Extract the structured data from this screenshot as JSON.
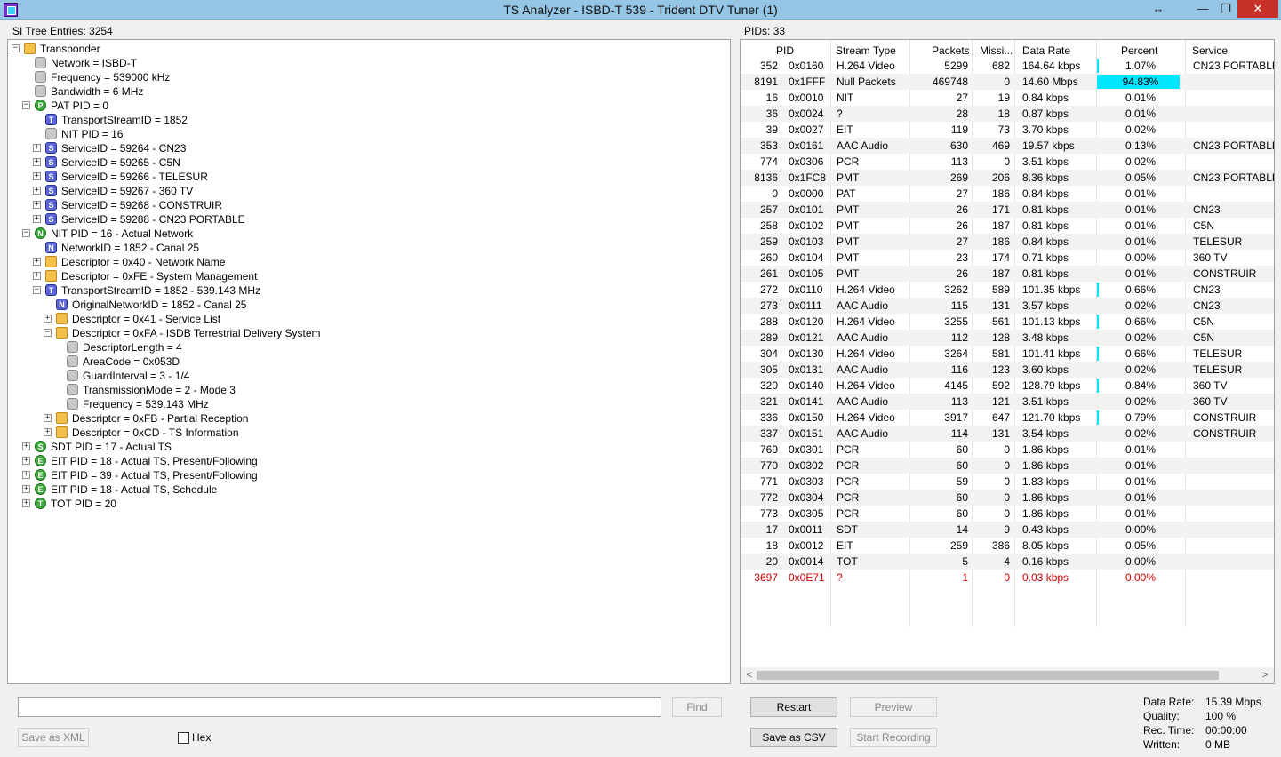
{
  "window": {
    "title": "TS Analyzer - ISBD-T 539 - Trident DTV Tuner (1)"
  },
  "left": {
    "label": "SI Tree Entries: 3254",
    "tree": [
      {
        "level": 0,
        "exp": "-",
        "icon": "folder",
        "text": "Transponder"
      },
      {
        "level": 1,
        "exp": "",
        "icon": "leaf",
        "text": "Network = ISBD-T"
      },
      {
        "level": 1,
        "exp": "",
        "icon": "leaf",
        "text": "Frequency = 539000 kHz"
      },
      {
        "level": 1,
        "exp": "",
        "icon": "leaf",
        "text": "Bandwidth = 6 MHz"
      },
      {
        "level": 1,
        "exp": "-",
        "icon": "P",
        "text": "PAT PID = 0"
      },
      {
        "level": 2,
        "exp": "",
        "icon": "T",
        "text": "TransportStreamID = 1852"
      },
      {
        "level": 2,
        "exp": "",
        "icon": "leaf",
        "text": "NIT PID = 16"
      },
      {
        "level": 2,
        "exp": "+",
        "icon": "S",
        "text": "ServiceID = 59264 - CN23"
      },
      {
        "level": 2,
        "exp": "+",
        "icon": "S",
        "text": "ServiceID = 59265 - C5N"
      },
      {
        "level": 2,
        "exp": "+",
        "icon": "S",
        "text": "ServiceID = 59266 - TELESUR"
      },
      {
        "level": 2,
        "exp": "+",
        "icon": "S",
        "text": "ServiceID = 59267 - 360 TV"
      },
      {
        "level": 2,
        "exp": "+",
        "icon": "S",
        "text": "ServiceID = 59268 - CONSTRUIR"
      },
      {
        "level": 2,
        "exp": "+",
        "icon": "S",
        "text": "ServiceID = 59288 - CN23 PORTABLE"
      },
      {
        "level": 1,
        "exp": "-",
        "icon": "N",
        "text": "NIT PID = 16 - Actual Network"
      },
      {
        "level": 2,
        "exp": "",
        "icon": "Nw",
        "text": "NetworkID = 1852 - Canal 25"
      },
      {
        "level": 2,
        "exp": "+",
        "icon": "folder",
        "text": "Descriptor = 0x40 - Network Name"
      },
      {
        "level": 2,
        "exp": "+",
        "icon": "folder",
        "text": "Descriptor = 0xFE - System Management"
      },
      {
        "level": 2,
        "exp": "-",
        "icon": "T",
        "text": "TransportStreamID = 1852 - 539.143 MHz"
      },
      {
        "level": 3,
        "exp": "",
        "icon": "Nw",
        "text": "OriginalNetworkID = 1852 - Canal 25"
      },
      {
        "level": 3,
        "exp": "+",
        "icon": "folder",
        "text": "Descriptor = 0x41 - Service List"
      },
      {
        "level": 3,
        "exp": "-",
        "icon": "folder",
        "text": "Descriptor = 0xFA - ISDB Terrestrial Delivery System"
      },
      {
        "level": 4,
        "exp": "",
        "icon": "leaf",
        "text": "DescriptorLength = 4"
      },
      {
        "level": 4,
        "exp": "",
        "icon": "leaf",
        "text": "AreaCode = 0x053D"
      },
      {
        "level": 4,
        "exp": "",
        "icon": "leaf",
        "text": "GuardInterval = 3 - 1/4"
      },
      {
        "level": 4,
        "exp": "",
        "icon": "leaf",
        "text": "TransmissionMode = 2 - Mode 3"
      },
      {
        "level": 4,
        "exp": "",
        "icon": "leaf",
        "text": "Frequency = 539.143 MHz"
      },
      {
        "level": 3,
        "exp": "+",
        "icon": "folder",
        "text": "Descriptor = 0xFB - Partial Reception"
      },
      {
        "level": 3,
        "exp": "+",
        "icon": "folder",
        "text": "Descriptor = 0xCD - TS Information"
      },
      {
        "level": 1,
        "exp": "+",
        "icon": "S",
        "text": "SDT PID = 17 - Actual TS"
      },
      {
        "level": 1,
        "exp": "+",
        "icon": "E",
        "text": "EIT PID = 18 - Actual TS, Present/Following"
      },
      {
        "level": 1,
        "exp": "+",
        "icon": "E",
        "text": "EIT PID = 39 - Actual TS, Present/Following"
      },
      {
        "level": 1,
        "exp": "+",
        "icon": "E",
        "text": "EIT PID = 18 - Actual TS, Schedule"
      },
      {
        "level": 1,
        "exp": "+",
        "icon": "T",
        "text": "TOT PID = 20"
      }
    ],
    "find_button": "Find",
    "save_xml_button": "Save as XML",
    "hex_label": "Hex"
  },
  "right": {
    "label": "PIDs: 33",
    "columns": [
      "PID",
      "Stream Type",
      "Packets",
      "Missi...",
      "Data Rate",
      "Percent",
      "Service"
    ],
    "rows": [
      {
        "pid": "352",
        "hex": "0x0160",
        "type": "H.264 Video",
        "packets": "5299",
        "missing": "682",
        "rate": "164.64 kbps",
        "percent": "1.07%",
        "pct": 1.07,
        "service": "CN23 PORTABLE"
      },
      {
        "pid": "8191",
        "hex": "0x1FFF",
        "type": "Null Packets",
        "packets": "469748",
        "missing": "0",
        "rate": "14.60 Mbps",
        "percent": "94.83%",
        "pct": 94.83,
        "service": ""
      },
      {
        "pid": "16",
        "hex": "0x0010",
        "type": "NIT",
        "packets": "27",
        "missing": "19",
        "rate": "0.84 kbps",
        "percent": "0.01%",
        "pct": 0.01,
        "service": ""
      },
      {
        "pid": "36",
        "hex": "0x0024",
        "type": "?",
        "packets": "28",
        "missing": "18",
        "rate": "0.87 kbps",
        "percent": "0.01%",
        "pct": 0.01,
        "service": ""
      },
      {
        "pid": "39",
        "hex": "0x0027",
        "type": "EIT",
        "packets": "119",
        "missing": "73",
        "rate": "3.70 kbps",
        "percent": "0.02%",
        "pct": 0.02,
        "service": ""
      },
      {
        "pid": "353",
        "hex": "0x0161",
        "type": "AAC Audio",
        "packets": "630",
        "missing": "469",
        "rate": "19.57 kbps",
        "percent": "0.13%",
        "pct": 0.13,
        "service": "CN23 PORTABLE"
      },
      {
        "pid": "774",
        "hex": "0x0306",
        "type": "PCR",
        "packets": "113",
        "missing": "0",
        "rate": "3.51 kbps",
        "percent": "0.02%",
        "pct": 0.02,
        "service": ""
      },
      {
        "pid": "8136",
        "hex": "0x1FC8",
        "type": "PMT",
        "packets": "269",
        "missing": "206",
        "rate": "8.36 kbps",
        "percent": "0.05%",
        "pct": 0.05,
        "service": "CN23 PORTABLE"
      },
      {
        "pid": "0",
        "hex": "0x0000",
        "type": "PAT",
        "packets": "27",
        "missing": "186",
        "rate": "0.84 kbps",
        "percent": "0.01%",
        "pct": 0.01,
        "service": ""
      },
      {
        "pid": "257",
        "hex": "0x0101",
        "type": "PMT",
        "packets": "26",
        "missing": "171",
        "rate": "0.81 kbps",
        "percent": "0.01%",
        "pct": 0.01,
        "service": "CN23"
      },
      {
        "pid": "258",
        "hex": "0x0102",
        "type": "PMT",
        "packets": "26",
        "missing": "187",
        "rate": "0.81 kbps",
        "percent": "0.01%",
        "pct": 0.01,
        "service": "C5N"
      },
      {
        "pid": "259",
        "hex": "0x0103",
        "type": "PMT",
        "packets": "27",
        "missing": "186",
        "rate": "0.84 kbps",
        "percent": "0.01%",
        "pct": 0.01,
        "service": "TELESUR"
      },
      {
        "pid": "260",
        "hex": "0x0104",
        "type": "PMT",
        "packets": "23",
        "missing": "174",
        "rate": "0.71 kbps",
        "percent": "0.00%",
        "pct": 0.0,
        "service": "360 TV"
      },
      {
        "pid": "261",
        "hex": "0x0105",
        "type": "PMT",
        "packets": "26",
        "missing": "187",
        "rate": "0.81 kbps",
        "percent": "0.01%",
        "pct": 0.01,
        "service": "CONSTRUIR"
      },
      {
        "pid": "272",
        "hex": "0x0110",
        "type": "H.264 Video",
        "packets": "3262",
        "missing": "589",
        "rate": "101.35 kbps",
        "percent": "0.66%",
        "pct": 0.66,
        "service": "CN23"
      },
      {
        "pid": "273",
        "hex": "0x0111",
        "type": "AAC Audio",
        "packets": "115",
        "missing": "131",
        "rate": "3.57 kbps",
        "percent": "0.02%",
        "pct": 0.02,
        "service": "CN23"
      },
      {
        "pid": "288",
        "hex": "0x0120",
        "type": "H.264 Video",
        "packets": "3255",
        "missing": "561",
        "rate": "101.13 kbps",
        "percent": "0.66%",
        "pct": 0.66,
        "service": "C5N"
      },
      {
        "pid": "289",
        "hex": "0x0121",
        "type": "AAC Audio",
        "packets": "112",
        "missing": "128",
        "rate": "3.48 kbps",
        "percent": "0.02%",
        "pct": 0.02,
        "service": "C5N"
      },
      {
        "pid": "304",
        "hex": "0x0130",
        "type": "H.264 Video",
        "packets": "3264",
        "missing": "581",
        "rate": "101.41 kbps",
        "percent": "0.66%",
        "pct": 0.66,
        "service": "TELESUR"
      },
      {
        "pid": "305",
        "hex": "0x0131",
        "type": "AAC Audio",
        "packets": "116",
        "missing": "123",
        "rate": "3.60 kbps",
        "percent": "0.02%",
        "pct": 0.02,
        "service": "TELESUR"
      },
      {
        "pid": "320",
        "hex": "0x0140",
        "type": "H.264 Video",
        "packets": "4145",
        "missing": "592",
        "rate": "128.79 kbps",
        "percent": "0.84%",
        "pct": 0.84,
        "service": "360 TV"
      },
      {
        "pid": "321",
        "hex": "0x0141",
        "type": "AAC Audio",
        "packets": "113",
        "missing": "121",
        "rate": "3.51 kbps",
        "percent": "0.02%",
        "pct": 0.02,
        "service": "360 TV"
      },
      {
        "pid": "336",
        "hex": "0x0150",
        "type": "H.264 Video",
        "packets": "3917",
        "missing": "647",
        "rate": "121.70 kbps",
        "percent": "0.79%",
        "pct": 0.79,
        "service": "CONSTRUIR"
      },
      {
        "pid": "337",
        "hex": "0x0151",
        "type": "AAC Audio",
        "packets": "114",
        "missing": "131",
        "rate": "3.54 kbps",
        "percent": "0.02%",
        "pct": 0.02,
        "service": "CONSTRUIR"
      },
      {
        "pid": "769",
        "hex": "0x0301",
        "type": "PCR",
        "packets": "60",
        "missing": "0",
        "rate": "1.86 kbps",
        "percent": "0.01%",
        "pct": 0.01,
        "service": ""
      },
      {
        "pid": "770",
        "hex": "0x0302",
        "type": "PCR",
        "packets": "60",
        "missing": "0",
        "rate": "1.86 kbps",
        "percent": "0.01%",
        "pct": 0.01,
        "service": ""
      },
      {
        "pid": "771",
        "hex": "0x0303",
        "type": "PCR",
        "packets": "59",
        "missing": "0",
        "rate": "1.83 kbps",
        "percent": "0.01%",
        "pct": 0.01,
        "service": ""
      },
      {
        "pid": "772",
        "hex": "0x0304",
        "type": "PCR",
        "packets": "60",
        "missing": "0",
        "rate": "1.86 kbps",
        "percent": "0.01%",
        "pct": 0.01,
        "service": ""
      },
      {
        "pid": "773",
        "hex": "0x0305",
        "type": "PCR",
        "packets": "60",
        "missing": "0",
        "rate": "1.86 kbps",
        "percent": "0.01%",
        "pct": 0.01,
        "service": ""
      },
      {
        "pid": "17",
        "hex": "0x0011",
        "type": "SDT",
        "packets": "14",
        "missing": "9",
        "rate": "0.43 kbps",
        "percent": "0.00%",
        "pct": 0.0,
        "service": ""
      },
      {
        "pid": "18",
        "hex": "0x0012",
        "type": "EIT",
        "packets": "259",
        "missing": "386",
        "rate": "8.05 kbps",
        "percent": "0.05%",
        "pct": 0.05,
        "service": ""
      },
      {
        "pid": "20",
        "hex": "0x0014",
        "type": "TOT",
        "packets": "5",
        "missing": "4",
        "rate": "0.16 kbps",
        "percent": "0.00%",
        "pct": 0.0,
        "service": ""
      },
      {
        "pid": "3697",
        "hex": "0x0E71",
        "type": "?",
        "packets": "1",
        "missing": "0",
        "rate": "0.03 kbps",
        "percent": "0.00%",
        "pct": 0.0,
        "service": "",
        "error": true
      }
    ],
    "restart_button": "Restart",
    "preview_button": "Preview",
    "save_csv_button": "Save as CSV",
    "start_recording_button": "Start Recording",
    "stats": [
      {
        "label": "Data Rate:",
        "value": "15.39 Mbps"
      },
      {
        "label": "Quality:",
        "value": "100 %"
      },
      {
        "label": "Rec. Time:",
        "value": "00:00:00"
      },
      {
        "label": "Written:",
        "value": "0 MB"
      }
    ]
  },
  "colors": {
    "titlebar": "#96c6e6",
    "percent_bar": "#00e6ff",
    "error_text": "#d00000",
    "close_button": "#c7312a"
  }
}
